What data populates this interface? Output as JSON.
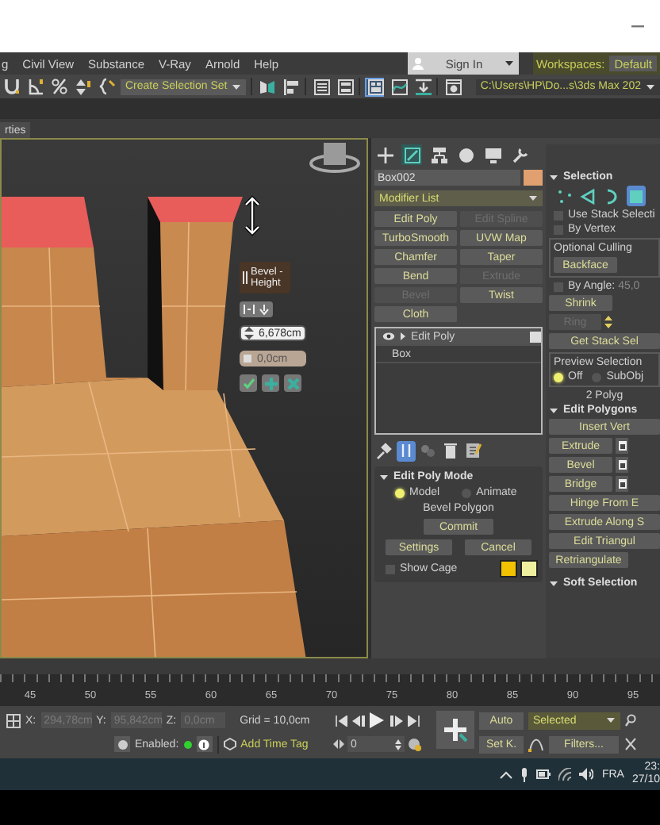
{
  "menu_bar": {
    "items": [
      "g",
      "Civil View",
      "Substance",
      "V-Ray",
      "Arnold",
      "Help"
    ],
    "sign_in": "Sign In",
    "workspaces_label": "Workspaces:",
    "workspace": "Default"
  },
  "toolbar": {
    "left_tools": [
      {
        "kind": "snap",
        "selected": false
      },
      {
        "kind": "angle-snap",
        "selected": false
      },
      {
        "kind": "percent-snap",
        "selected": false
      },
      {
        "kind": "spinner-snap",
        "selected": false
      },
      {
        "kind": "named-sets",
        "selected": false
      }
    ],
    "selection_set": "Create Selection Set",
    "right_tools": [
      {
        "kind": "mirror",
        "selected": false
      },
      {
        "kind": "align",
        "selected": false
      },
      {
        "kind": "list",
        "selected": false
      },
      {
        "kind": "layers",
        "selected": false
      },
      {
        "kind": "ribbon",
        "selected": true
      },
      {
        "kind": "curves",
        "selected": false
      },
      {
        "kind": "schematic",
        "selected": false
      },
      {
        "kind": "render",
        "selected": false
      }
    ],
    "project_path": "C:\\Users\\HP\\Do...s\\3ds Max 202"
  },
  "properties_tab": "rties",
  "viewport": {
    "caddy": {
      "label": "Bevel -Height",
      "height": "6,678cm",
      "outline": "0,0cm"
    }
  },
  "command_panel": {
    "tabs": [
      {
        "kind": "create",
        "selected": false
      },
      {
        "kind": "modify",
        "selected": true
      },
      {
        "kind": "hierarchy",
        "selected": false
      },
      {
        "kind": "motion",
        "selected": false
      },
      {
        "kind": "display",
        "selected": false
      },
      {
        "kind": "utilities",
        "selected": false
      }
    ],
    "object_name": "Box002",
    "modifier_list": "Modifier List",
    "modifiers": [
      {
        "label": "Edit Poly",
        "disabled": false
      },
      {
        "label": "Edit Spline",
        "disabled": true
      },
      {
        "label": "TurboSmooth",
        "disabled": false
      },
      {
        "label": "UVW Map",
        "disabled": false
      },
      {
        "label": "Chamfer",
        "disabled": false
      },
      {
        "label": "Taper",
        "disabled": false
      },
      {
        "label": "Bend",
        "disabled": false
      },
      {
        "label": "Extrude",
        "disabled": true
      },
      {
        "label": "Bevel",
        "disabled": true
      },
      {
        "label": "Twist",
        "disabled": false
      },
      {
        "label": "Cloth",
        "disabled": false
      }
    ],
    "stack": [
      {
        "label": "Edit Poly",
        "kind": "modifier",
        "selected": true
      },
      {
        "label": "Box",
        "kind": "base",
        "selected": false
      }
    ],
    "stack_tools": [
      {
        "kind": "pin",
        "selected": false
      },
      {
        "kind": "show-end",
        "selected": true
      },
      {
        "kind": "unique",
        "selected": false
      },
      {
        "kind": "delete",
        "selected": false
      },
      {
        "kind": "configure",
        "selected": false
      }
    ]
  },
  "edit_poly_mode": {
    "title": "Edit Poly Mode",
    "modes": [
      {
        "label": "Model",
        "selected": true
      },
      {
        "label": "Animate",
        "selected": false
      }
    ],
    "operation": "Bevel Polygon",
    "commit": "Commit",
    "settings": "Settings",
    "cancel": "Cancel",
    "show_cage": {
      "label": "Show Cage",
      "checked": false
    },
    "cage_colors": [
      {
        "color": "#f2c200"
      },
      {
        "color": "#eef0a0"
      }
    ]
  },
  "selection": {
    "title": "Selection",
    "levels": [
      {
        "kind": "vertex",
        "selected": false
      },
      {
        "kind": "edge",
        "selected": false
      },
      {
        "kind": "border",
        "selected": false
      },
      {
        "kind": "polygon",
        "selected": true
      }
    ],
    "use_stack": {
      "label": "Use Stack Selecti",
      "checked": false
    },
    "by_vertex": {
      "label": "By Vertex",
      "checked": false
    },
    "culling_label": "Optional Culling",
    "backface": "Backface",
    "by_angle": {
      "label": "By Angle:",
      "checked": false
    },
    "angle": "45,0",
    "shrink": "Shrink",
    "ring": {
      "label": "Ring",
      "disabled": true
    },
    "get_stack": "Get Stack Sel",
    "preview_label": "Preview Selection",
    "preview": [
      {
        "label": "Off",
        "selected": true
      },
      {
        "label": "SubObj",
        "selected": false
      }
    ],
    "status": "2 Polyg"
  },
  "edit_polygons": {
    "title": "Edit Polygons",
    "buttons": [
      {
        "label": "Insert Vert",
        "kind": "wide"
      },
      {
        "label": "Extrude",
        "kind": "settings"
      },
      {
        "label": "Bevel",
        "kind": "settings"
      },
      {
        "label": "Bridge",
        "kind": "settings"
      },
      {
        "label": "Hinge From E",
        "kind": "wide"
      },
      {
        "label": "Extrude Along S",
        "kind": "wide"
      },
      {
        "label": "Edit Triangul",
        "kind": "wide"
      },
      {
        "label": "Retriangulate",
        "kind": "half"
      }
    ]
  },
  "soft_selection": {
    "title": "Soft Selection"
  },
  "timeline": {
    "ticks": [
      "45",
      "50",
      "55",
      "60",
      "65",
      "70",
      "75",
      "80",
      "85",
      "90",
      "95"
    ]
  },
  "status_bar": {
    "x_label": "X:",
    "x": "294,78cm",
    "y_label": "Y:",
    "y": "95,842cm",
    "z_label": "Z:",
    "z": "0,0cm",
    "grid": "Grid = 10,0cm",
    "enabled_label": "Enabled:",
    "enabled": true,
    "add_time_tag": "Add Time Tag",
    "frame": "0",
    "auto_key": "Auto",
    "set_key": "Set K.",
    "key_filter": "Selected",
    "filters": "Filters..."
  },
  "taskbar": {
    "language": "FRA",
    "time": "23:",
    "date": "27/10"
  }
}
